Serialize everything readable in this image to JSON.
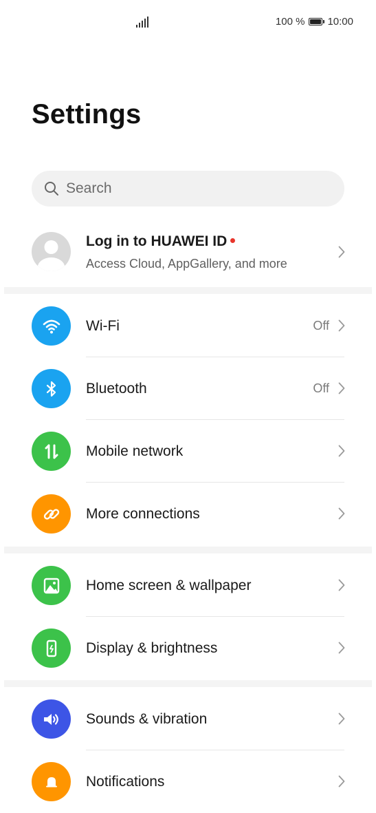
{
  "status_bar": {
    "battery_text": "100 %",
    "time": "10:00"
  },
  "header": {
    "title": "Settings"
  },
  "search": {
    "placeholder": "Search"
  },
  "account": {
    "title": "Log in to HUAWEI ID",
    "subtitle": "Access Cloud, AppGallery, and more"
  },
  "groups": [
    {
      "items": [
        {
          "label": "Wi-Fi",
          "value": "Off",
          "icon": "wifi-icon",
          "color": "#1aa3f0"
        },
        {
          "label": "Bluetooth",
          "value": "Off",
          "icon": "bluetooth-icon",
          "color": "#1aa3f0"
        },
        {
          "label": "Mobile network",
          "value": "",
          "icon": "mobile-network-icon",
          "color": "#3cc24a"
        },
        {
          "label": "More connections",
          "value": "",
          "icon": "link-icon",
          "color": "#ff9500"
        }
      ]
    },
    {
      "items": [
        {
          "label": "Home screen & wallpaper",
          "value": "",
          "icon": "image-icon",
          "color": "#3cc24a"
        },
        {
          "label": "Display & brightness",
          "value": "",
          "icon": "display-icon",
          "color": "#3cc24a"
        }
      ]
    },
    {
      "items": [
        {
          "label": "Sounds & vibration",
          "value": "",
          "icon": "speaker-icon",
          "color": "#3d55e6"
        },
        {
          "label": "Notifications",
          "value": "",
          "icon": "bell-icon",
          "color": "#ff9500"
        }
      ]
    }
  ]
}
